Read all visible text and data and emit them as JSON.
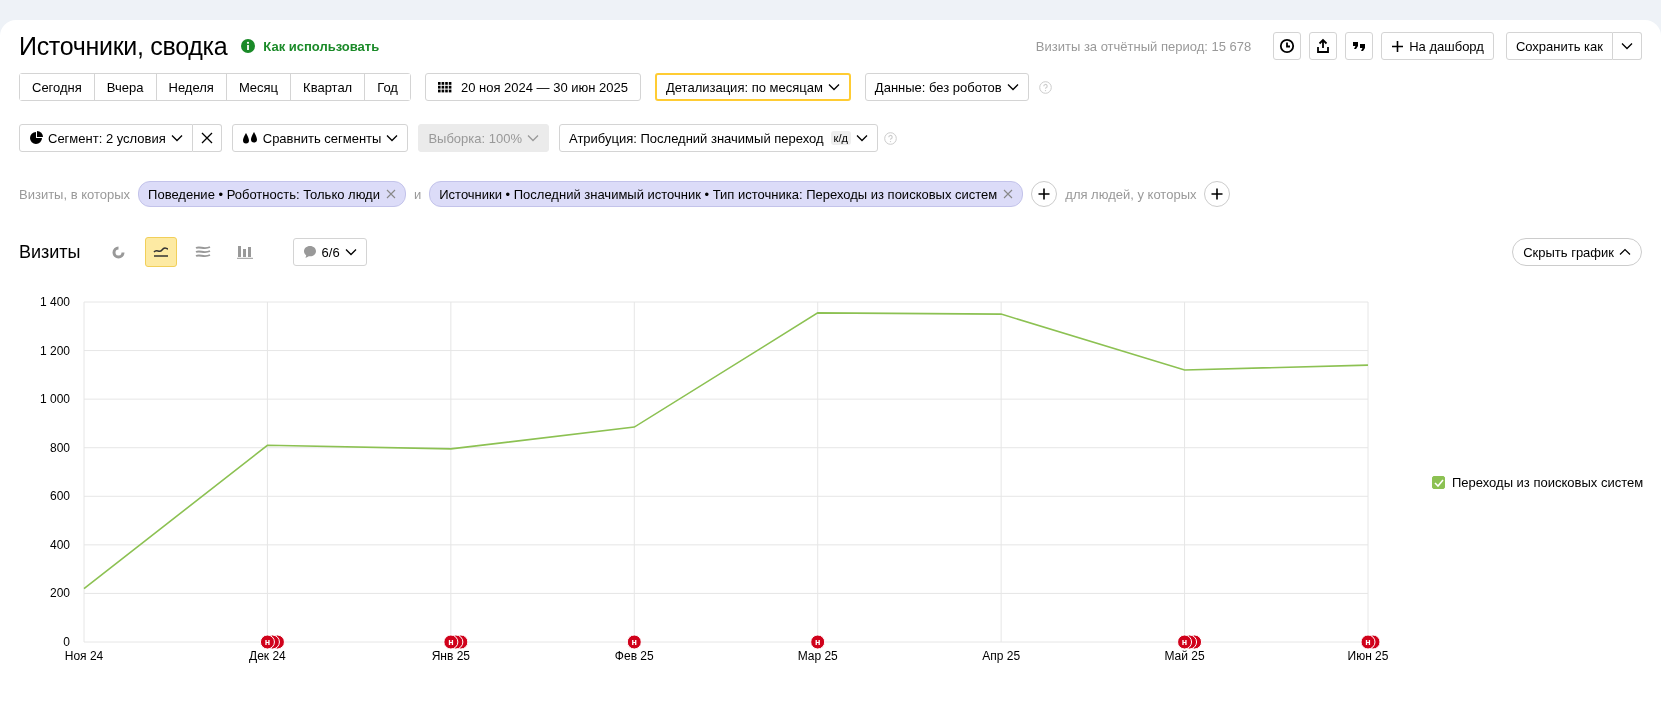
{
  "header": {
    "title": "Источники, сводка",
    "help_link": "Как использовать",
    "total": "Визиты за отчётный период: 15 678",
    "add_button": "На дашборд",
    "save_button": "Сохранить как"
  },
  "periods": [
    {
      "label": "Сегодня"
    },
    {
      "label": "Вчера"
    },
    {
      "label": "Неделя"
    },
    {
      "label": "Месяц"
    },
    {
      "label": "Квартал"
    },
    {
      "label": "Год"
    }
  ],
  "date_range": "20 ноя 2024 — 30 июн 2025",
  "selects": [
    {
      "label": "Детализация: по месяцам",
      "focused": true
    },
    {
      "label": "Данные: без роботов",
      "focused": false
    }
  ],
  "segment": {
    "label": "Сегмент: 2 условия",
    "compare": "Сравнить сегменты",
    "sample": {
      "label": "Выборка: 100%",
      "disabled": true
    },
    "attribution": "Атрибуция: Последний значимый переход",
    "attribution_badge": "к/д"
  },
  "filters": {
    "lead": "Визиты, в которых",
    "conditions": [
      "Поведение • Роботность: Только люди",
      "Источники • Последний значимый источник • Тип источника: Переходы из поисковых систем"
    ],
    "joiner": "и",
    "people_lead": "для людей, у которых"
  },
  "chart_panel": {
    "title": "Визиты",
    "view_types": [
      {
        "kind": "pie",
        "selected": false
      },
      {
        "kind": "line",
        "selected": true
      },
      {
        "kind": "area",
        "selected": false
      },
      {
        "kind": "bar",
        "selected": false
      }
    ],
    "annotations_toggle": "6/6",
    "hide_button": "Скрыть график",
    "chart_data": {
      "type": "line",
      "grid": true,
      "categories": [
        "Ноя 24",
        "Дек 24",
        "Янв 25",
        "Фев 25",
        "Мар 25",
        "Апр 25",
        "Май 25",
        "Июн 25"
      ],
      "series": [
        {
          "name": "Переходы из поисковых систем",
          "color": "#8cc152",
          "values": [
            220,
            810,
            795,
            885,
            1355,
            1350,
            1120,
            1140
          ]
        }
      ],
      "ylim": [
        0,
        1400
      ],
      "yticks": [
        {
          "value": 0,
          "label": "0"
        },
        {
          "value": 200,
          "label": "200"
        },
        {
          "value": 400,
          "label": "400"
        },
        {
          "value": 600,
          "label": "600"
        },
        {
          "value": 800,
          "label": "800"
        },
        {
          "value": 1000,
          "label": "1 000"
        },
        {
          "value": 1200,
          "label": "1 200"
        },
        {
          "value": 1400,
          "label": "1 400"
        }
      ]
    },
    "event_markers": [
      {
        "kind": "none"
      },
      {
        "kind": "triple",
        "label": "н"
      },
      {
        "kind": "triple",
        "label": "н"
      },
      {
        "kind": "single",
        "label": "н"
      },
      {
        "kind": "single",
        "label": "н"
      },
      {
        "kind": "none"
      },
      {
        "kind": "triple",
        "label": "н"
      },
      {
        "kind": "double",
        "label": "н"
      }
    ],
    "legend": [
      {
        "checked": true
      }
    ]
  }
}
